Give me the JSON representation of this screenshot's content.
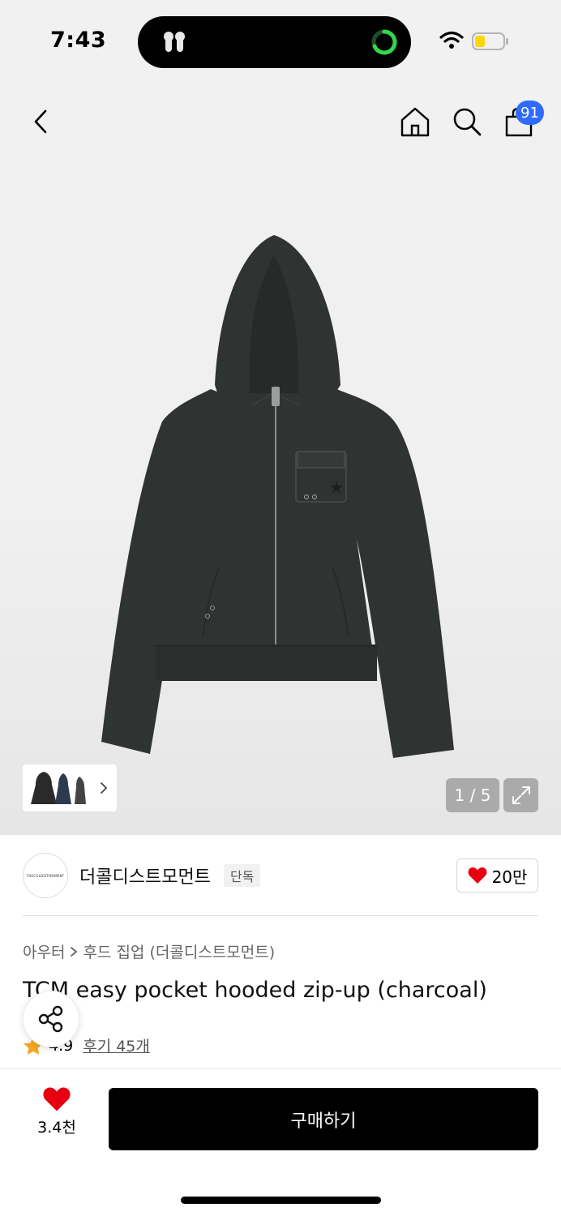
{
  "status_bar": {
    "time": "7:43"
  },
  "nav": {
    "back_icon": "chevron-left-icon",
    "home_icon": "home-icon",
    "search_icon": "search-icon",
    "cart_icon": "shopping-bag-icon",
    "cart_badge": "91",
    "badge_color": "#2f6bff"
  },
  "gallery": {
    "counter": "1 / 5",
    "expand_icon": "expand-icon",
    "product_color": "#2f3331"
  },
  "brand": {
    "logo_text": "THECOLDISTMOMENT",
    "name": "더콜디스트모먼트",
    "tag": "단독",
    "likes": "20만",
    "heart_color": "#e60012"
  },
  "product": {
    "breadcrumb": [
      "아우터",
      "후드 집업 (더콜디스트모먼트)"
    ],
    "title": "TCM easy pocket hooded zip-up (charcoal)",
    "rating": "4.9",
    "reviews": "후기 45개"
  },
  "bottom_bar": {
    "wishlist_count": "3.4천",
    "buy_label": "구매하기"
  }
}
